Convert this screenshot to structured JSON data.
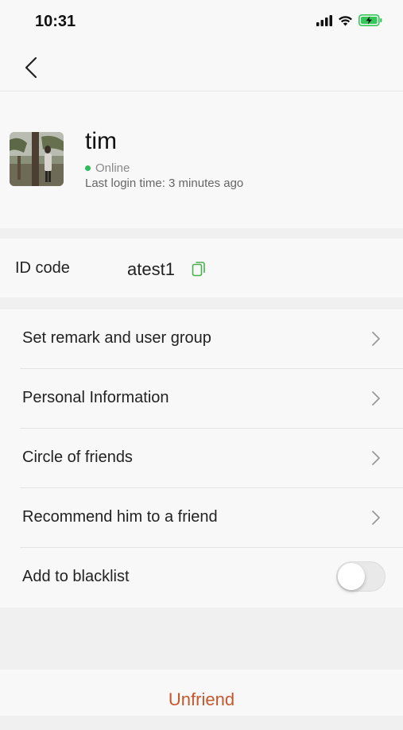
{
  "status_bar": {
    "time": "10:31"
  },
  "profile": {
    "name": "tim",
    "status": "Online",
    "last_login": "Last login time: 3 minutes ago"
  },
  "id_row": {
    "label": "ID code",
    "value": "atest1"
  },
  "menu": {
    "items": [
      {
        "label": "Set remark and user group"
      },
      {
        "label": "Personal Information"
      },
      {
        "label": "Circle of friends"
      },
      {
        "label": "Recommend him to a friend"
      }
    ],
    "blacklist": {
      "label": "Add to blacklist",
      "enabled": false
    }
  },
  "footer": {
    "unfriend_label": "Unfriend"
  },
  "colors": {
    "accent": "#c4572c",
    "online": "#2dbb5b",
    "copy_icon": "#4caf50",
    "battery": "#34c759"
  },
  "icons": [
    "signal-icon",
    "wifi-icon",
    "battery-charging-icon",
    "back-arrow-icon",
    "copy-icon",
    "chevron-right-icon"
  ]
}
